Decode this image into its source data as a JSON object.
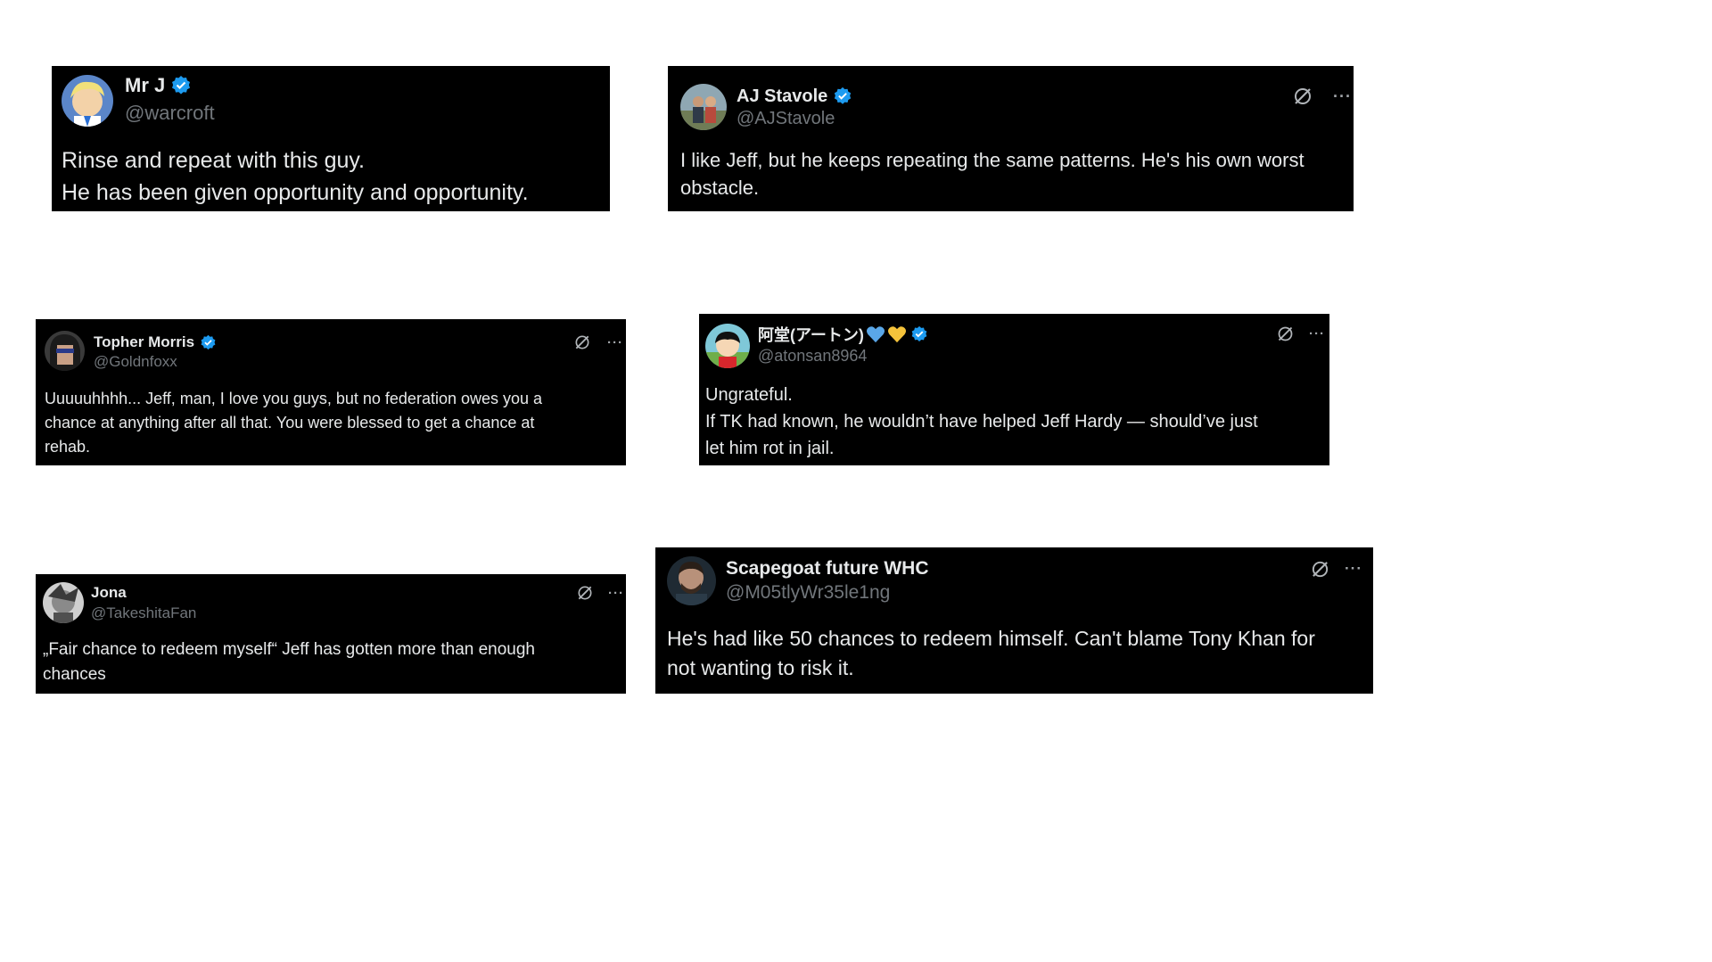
{
  "colors": {
    "card_bg": "#000000",
    "text": "#e7e9ea",
    "handle": "#71767b",
    "verified": "#1d9bf0",
    "page_bg": "#ffffff"
  },
  "tweets": [
    {
      "name": "Mr J",
      "handle": "@warcroft",
      "verified": true,
      "lines": [
        "Rinse and repeat with this guy.",
        "He has been given opportunity and opportunity."
      ]
    },
    {
      "name": "AJ Stavole",
      "handle": "@AJStavole",
      "verified": true,
      "lines": [
        "I like Jeff, but he keeps repeating the same patterns. He's his own worst",
        "obstacle."
      ]
    },
    {
      "name": "Topher Morris",
      "handle": "@Goldnfoxx",
      "verified": true,
      "lines": [
        "Uuuuuhhhh... Jeff, man, I love you guys, but no federation owes you a",
        "chance at anything after all that.  You were blessed to get a chance at",
        "rehab."
      ]
    },
    {
      "name": "阿堂(アートン)",
      "handle": "@atonsan8964",
      "verified": true,
      "emoji": [
        "blue-heart",
        "yellow-heart"
      ],
      "lines": [
        "Ungrateful.",
        "If TK had known, he wouldn’t have helped Jeff  Hardy — should’ve just",
        "let him rot in jail."
      ]
    },
    {
      "name": "Jona",
      "handle": "@TakeshitaFan",
      "verified": false,
      "lines": [
        "„Fair chance to redeem myself“ Jeff has gotten more than enough",
        "chances"
      ]
    },
    {
      "name": "Scapegoat future WHC",
      "handle": "@M05tlyWr35le1ng",
      "verified": false,
      "lines": [
        "He's had like 50 chances to redeem himself. Can't blame Tony Khan for",
        "not wanting to risk it."
      ]
    }
  ],
  "icons": {
    "grok": "grok-icon",
    "more": "more-icon",
    "more_glyph": "···"
  }
}
